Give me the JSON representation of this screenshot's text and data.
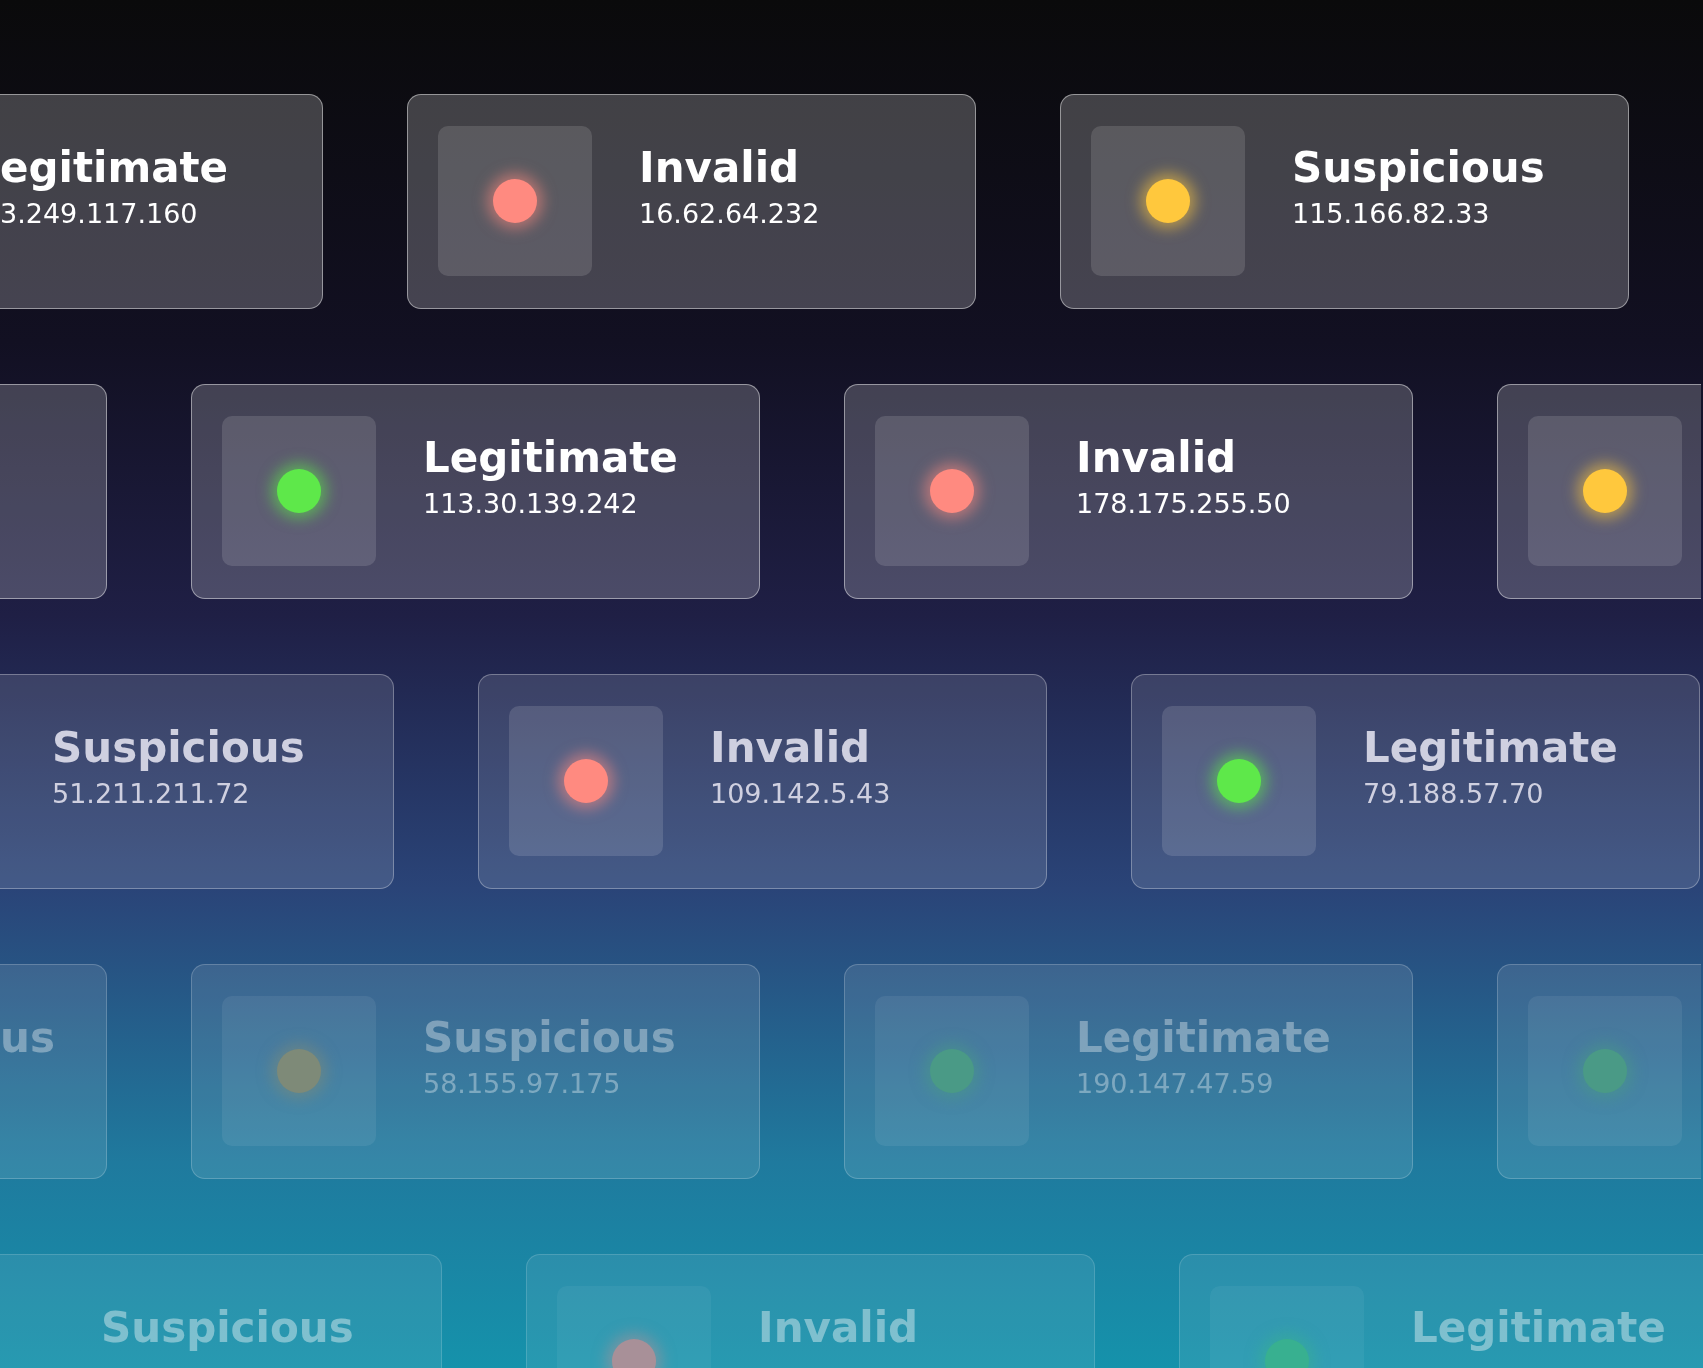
{
  "rows": [
    {
      "cards": [
        {
          "kind": "partial-left",
          "status": "egitimate",
          "ip": "3.249.117.160"
        },
        {
          "kind": "full",
          "status": "Invalid",
          "ip": "16.62.64.232",
          "color": "#ff8a80"
        },
        {
          "kind": "full",
          "status": "Suspicious",
          "ip": "115.166.82.33",
          "color": "#ffc83d"
        }
      ]
    },
    {
      "cards": [
        {
          "kind": "partial-left"
        },
        {
          "kind": "full",
          "status": "Legitimate",
          "ip": "113.30.139.242",
          "color": "#5ee84a"
        },
        {
          "kind": "full",
          "status": "Invalid",
          "ip": "178.175.255.50",
          "color": "#ff8a80"
        },
        {
          "kind": "partial-right",
          "color": "#ffc83d"
        }
      ]
    },
    {
      "cards": [
        {
          "kind": "partial-left",
          "status": "Suspicious",
          "ip": "51.211.211.72"
        },
        {
          "kind": "full",
          "status": "Invalid",
          "ip": "109.142.5.43",
          "color": "#ff8a80"
        },
        {
          "kind": "full",
          "status": "Legitimate",
          "ip": "79.188.57.70",
          "color": "#5ee84a"
        }
      ]
    },
    {
      "cards": [
        {
          "kind": "partial-left",
          "status": "us"
        },
        {
          "kind": "full",
          "status": "Suspicious",
          "ip": "58.155.97.175",
          "color": "#7e8a78"
        },
        {
          "kind": "full",
          "status": "Legitimate",
          "ip": "190.147.47.59",
          "color": "#4a9a86"
        },
        {
          "kind": "partial-right",
          "color": "#4a9a86"
        }
      ]
    },
    {
      "cards": [
        {
          "kind": "partial-left",
          "status": "Suspicious"
        },
        {
          "kind": "full",
          "status": "Invalid",
          "color": "#a89098"
        },
        {
          "kind": "full",
          "status": "Legitimate",
          "color": "#38b090"
        }
      ]
    }
  ]
}
